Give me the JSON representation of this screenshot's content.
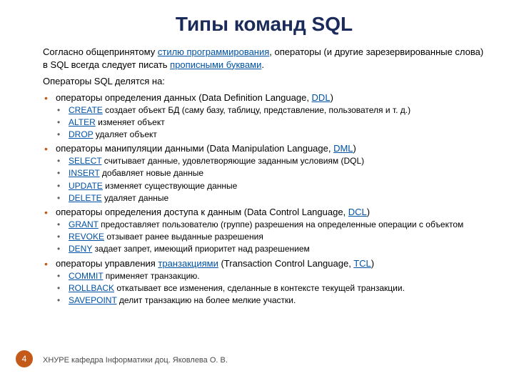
{
  "title": "Типы команд SQL",
  "intro": {
    "pre": "Согласно общепринятому ",
    "link1": "стилю программирования",
    "mid": ", операторы (и другие зарезервированные слова) в SQL всегда следует писать ",
    "link2": "прописными буквами",
    "post": "."
  },
  "subtitle": "Операторы SQL делятся на:",
  "categories": [
    {
      "label_pre": "операторы определения данных (",
      "label_eng": "Data Definition Language, ",
      "label_link": "DDL",
      "label_post": ")",
      "items": [
        {
          "cmd": "CREATE",
          "desc": " создает объект БД (саму базу, таблицу, представление, пользователя и т. д.)"
        },
        {
          "cmd": "ALTER",
          "desc": " изменяет объект"
        },
        {
          "cmd": "DROP",
          "desc": " удаляет объект"
        }
      ]
    },
    {
      "label_pre": "операторы манипуляции данными (",
      "label_eng": "Data Manipulation Language, ",
      "label_link": "DML",
      "label_post": ")",
      "items": [
        {
          "cmd": "SELECT",
          "desc": " считывает данные, удовлетворяющие заданным условиям (DQL)"
        },
        {
          "cmd": "INSERT",
          "desc": " добавляет новые данные"
        },
        {
          "cmd": "UPDATE",
          "desc": " изменяет существующие данные"
        },
        {
          "cmd": "DELETE",
          "desc": " удаляет данные"
        }
      ]
    },
    {
      "label_pre": "операторы определения доступа к данным (",
      "label_eng": "Data Control Language, ",
      "label_link": "DCL",
      "label_post": ")",
      "items": [
        {
          "cmd": "GRANT",
          "desc": " предоставляет пользователю (группе) разрешения на определенные операции с объектом"
        },
        {
          "cmd": "REVOKE",
          "desc": " отзывает ранее выданные разрешения"
        },
        {
          "cmd": "DENY",
          "desc": " задает запрет, имеющий приоритет над разрешением"
        }
      ]
    },
    {
      "label_pre": "операторы управления ",
      "label_link0": "транзакциями",
      "label_mid": " (",
      "label_eng": "Transaction Control Language, ",
      "label_link": "TCL",
      "label_post": ")",
      "items": [
        {
          "cmd": "COMMIT",
          "desc": " применяет транзакцию."
        },
        {
          "cmd": "ROLLBACK",
          "desc": " откатывает все изменения, сделанные в контексте текущей транзакции."
        },
        {
          "cmd": "SAVEPOINT",
          "desc": " делит транзакцию на более мелкие участки."
        }
      ]
    }
  ],
  "footer": {
    "page": "4",
    "text": "ХНУРЕ кафедра Інформатики доц. Яковлева О. В."
  }
}
